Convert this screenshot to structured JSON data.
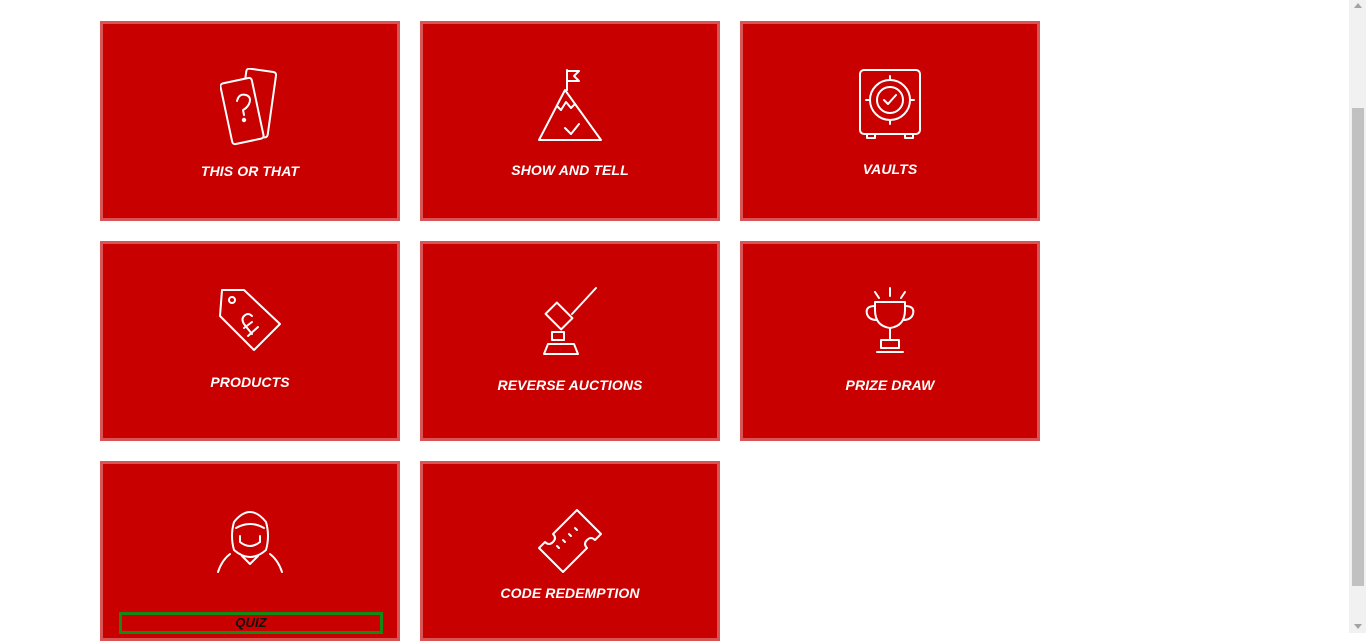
{
  "tiles": {
    "this_or_that": {
      "label": "THIS OR THAT",
      "icon": "question-cards-icon"
    },
    "show_and_tell": {
      "label": "SHOW AND TELL",
      "icon": "mountain-flag-icon"
    },
    "vaults": {
      "label": "VAULTS",
      "icon": "vault-safe-icon"
    },
    "products": {
      "label": "PRODUCTS",
      "icon": "price-tag-pound-icon"
    },
    "reverse_auctions": {
      "label": "REVERSE AUCTIONS",
      "icon": "gavel-icon"
    },
    "prize_draw": {
      "label": "PRIZE DRAW",
      "icon": "trophy-icon"
    },
    "quiz": {
      "label": "QUIZ",
      "icon": "quiz-host-icon"
    },
    "code_redemption": {
      "label": "CODE REDEMPTION",
      "icon": "ticket-icon"
    }
  },
  "colors": {
    "tile_bg": "#c90000",
    "tile_border": "#d95555",
    "focus_outline": "#138a13"
  }
}
